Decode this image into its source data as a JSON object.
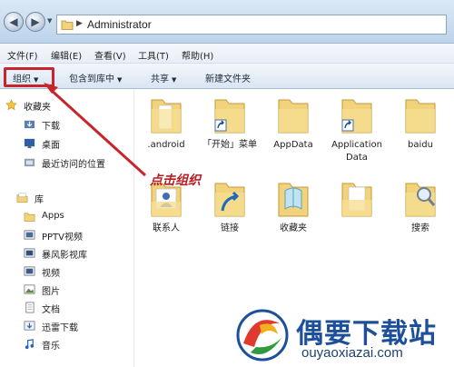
{
  "address_bar": {
    "path": "Administrator",
    "icons": [
      "back-arrow-icon",
      "forward-arrow-icon",
      "folder-icon"
    ]
  },
  "menu": {
    "items": [
      "文件(F)",
      "编辑(E)",
      "查看(V)",
      "工具(T)",
      "帮助(H)"
    ]
  },
  "command_bar": {
    "organize": "组织",
    "include_in_library": "包含到库中",
    "share": "共享",
    "new_folder": "新建文件夹"
  },
  "sidebar": {
    "favorites_header": "收藏夹",
    "favorites": [
      "下载",
      "桌面",
      "最近访问的位置"
    ],
    "libraries_header": "库",
    "libraries": [
      "Apps",
      "PPTV视频",
      "暴风影视库",
      "视频",
      "图片",
      "文档",
      "迅雷下载",
      "音乐"
    ]
  },
  "files": {
    "row1": [
      ".android",
      "「开始」菜单",
      "AppData",
      "Application Data",
      "baidu"
    ],
    "row2": [
      "联系人",
      "链接",
      "收藏夹",
      "",
      "搜索"
    ]
  },
  "annotation": {
    "text": "点击组织",
    "color": "#c7252b"
  },
  "watermark": {
    "title": "偶要下载站",
    "url": "ouyaoxiazai.com"
  },
  "colors": {
    "folder": "#f2d27a",
    "accent_red": "#c7252b",
    "selection_blue": "#cfe3fb"
  }
}
